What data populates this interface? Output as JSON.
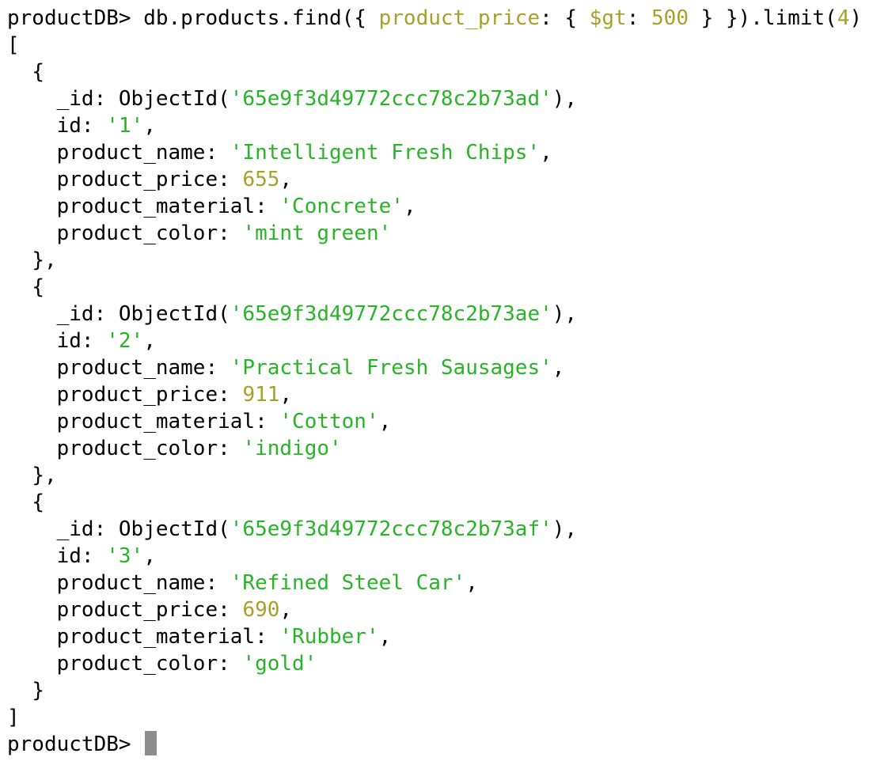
{
  "terminal": {
    "prompt": "productDB>",
    "command": {
      "prefix": " db.products.find({ ",
      "field": "product_price",
      "colon": ": { ",
      "operator": "$gt",
      "colon2": ": ",
      "value": "500",
      "suffix": " } }).limit(",
      "limit": "4",
      "close": ")"
    },
    "open_bracket": "[",
    "close_bracket": "]",
    "open_brace": "{",
    "close_brace": "}",
    "close_brace_comma": "},",
    "keys": {
      "_id": "_id: ObjectId(",
      "id": "id: ",
      "product_name": "product_name: ",
      "product_price": "product_price: ",
      "product_material": "product_material: ",
      "product_color": "product_color: "
    },
    "documents": [
      {
        "_id": "'65e9f3d49772ccc78c2b73ad'",
        "id": "'1'",
        "product_name": "'Intelligent Fresh Chips'",
        "product_price": "655",
        "product_material": "'Concrete'",
        "product_color": "'mint green'"
      },
      {
        "_id": "'65e9f3d49772ccc78c2b73ae'",
        "id": "'2'",
        "product_name": "'Practical Fresh Sausages'",
        "product_price": "911",
        "product_material": "'Cotton'",
        "product_color": "'indigo'"
      },
      {
        "_id": "'65e9f3d49772ccc78c2b73af'",
        "id": "'3'",
        "product_name": "'Refined Steel Car'",
        "product_price": "690",
        "product_material": "'Rubber'",
        "product_color": "'gold'"
      }
    ],
    "next_prompt": "productDB>"
  },
  "colors": {
    "background": "#ffffff",
    "text": "#000000",
    "string": "#27b427",
    "number": "#a7a02a",
    "cursor": "#8e8e8e"
  }
}
